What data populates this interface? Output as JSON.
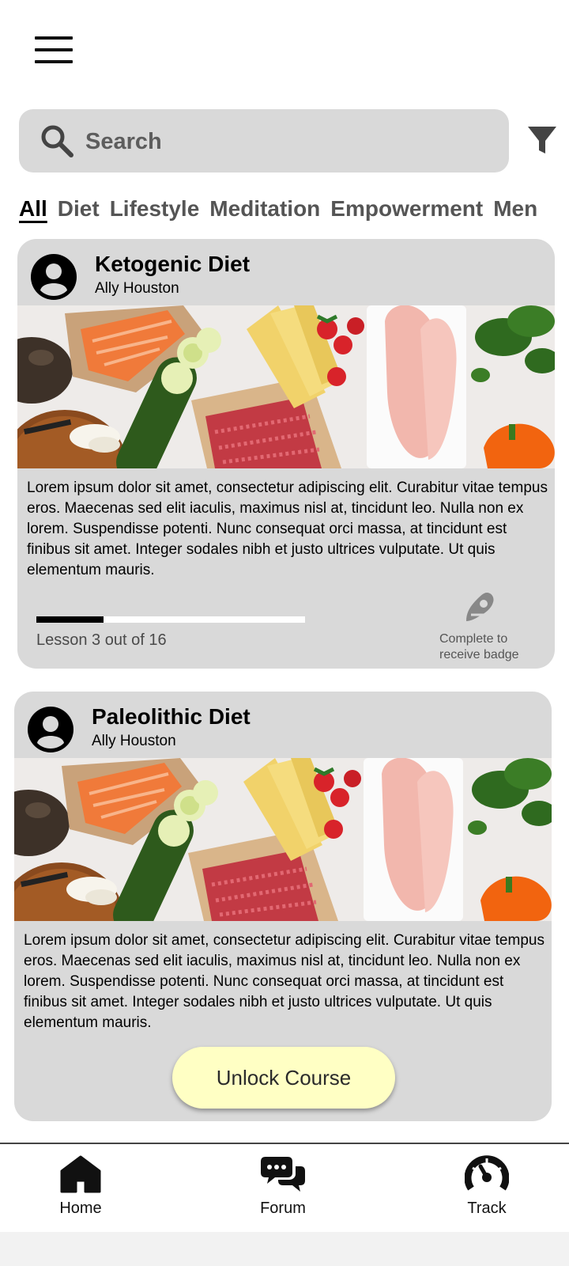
{
  "header": {
    "menu_icon": "hamburger-menu-icon"
  },
  "search": {
    "placeholder": "Search",
    "icon": "search-icon",
    "filter_icon": "filter-icon"
  },
  "tabs": [
    {
      "label": "All",
      "active": true
    },
    {
      "label": "Diet"
    },
    {
      "label": "Lifestyle"
    },
    {
      "label": "Meditation"
    },
    {
      "label": "Empowerment"
    },
    {
      "label": "Men"
    }
  ],
  "courses": [
    {
      "title": "Ketogenic Diet",
      "author": "Ally Houston",
      "description": "Lorem ipsum dolor sit amet, consectetur adipiscing elit. Curabitur vitae tempus eros. Maecenas sed elit iaculis, maximus nisl at, tincidunt leo. Nulla non ex lorem. Suspendisse potenti. Nunc consequat orci massa, at tincidunt est finibus sit amet. Integer sodales nibh et justo ultrices vulputate. Ut quis elementum mauris.",
      "progress_text": "Lesson 3 out of 16",
      "progress_fraction": 0.25,
      "badge_text": "Complete to receive badge"
    },
    {
      "title": "Paleolithic Diet",
      "author": "Ally Houston",
      "description": "Lorem ipsum dolor sit amet, consectetur adipiscing elit. Curabitur vitae tempus eros. Maecenas sed elit iaculis, maximus nisl at, tincidunt leo. Nulla non ex lorem. Suspendisse potenti. Nunc consequat orci massa, at tincidunt est finibus sit amet. Integer sodales nibh et justo ultrices vulputate. Ut quis elementum mauris.",
      "button_label": "Unlock Course"
    }
  ],
  "nav": [
    {
      "label": "Home",
      "icon": "home-icon"
    },
    {
      "label": "Forum",
      "icon": "chat-bubbles-icon"
    },
    {
      "label": "Track",
      "icon": "speedometer-icon"
    }
  ],
  "colors": {
    "card_bg": "#d9d9d9",
    "unlock_button": "#ffffc4",
    "search_bg": "#d9d9d9"
  }
}
